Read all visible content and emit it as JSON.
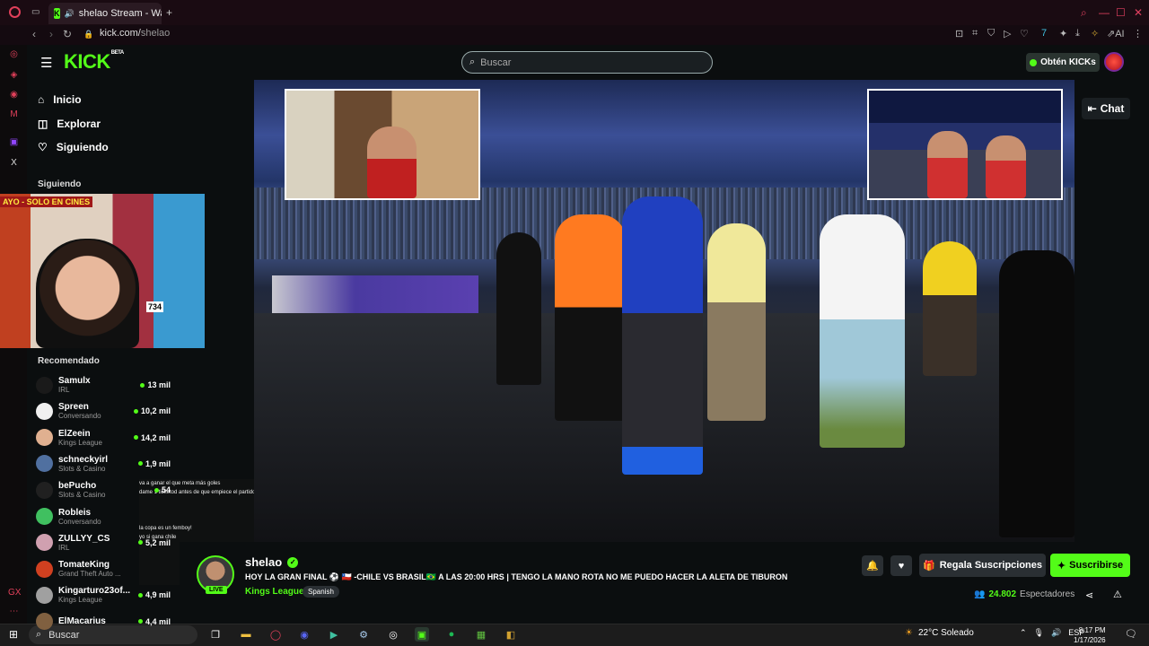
{
  "browser": {
    "tab_title": "shelao Stream - Watch",
    "new_tab": "+",
    "url": "kick.com/shelao",
    "url_host": "kick.com/",
    "url_path": "shelao",
    "ai_label": "AI"
  },
  "header": {
    "logo": "KICK",
    "logo_badge": "BETA",
    "search_placeholder": "Buscar",
    "get_kicks": "Obtén KICKs"
  },
  "sidebar": {
    "nav": [
      {
        "label": "Inicio",
        "icon": "home-icon"
      },
      {
        "label": "Explorar",
        "icon": "explore-icon"
      },
      {
        "label": "Siguiendo",
        "icon": "heart-icon"
      }
    ],
    "following_heading": "Siguiendo",
    "recommended_heading": "Recomendado",
    "recommended": [
      {
        "name": "Samulx",
        "category": "IRL",
        "viewers": "13 mil",
        "color": "#1a1a1a"
      },
      {
        "name": "Spreen",
        "category": "Conversando",
        "viewers": "10,2 mil",
        "color": "#f0f0f0"
      },
      {
        "name": "ElZeein",
        "category": "Kings League",
        "viewers": "14,2 mil",
        "color": "#e0b090"
      },
      {
        "name": "schneckyirl",
        "category": "Slots & Casino",
        "viewers": "1,9 mil",
        "color": "#5070a0"
      },
      {
        "name": "bePucho",
        "category": "Slots & Casino",
        "viewers": "54",
        "color": "#202020"
      },
      {
        "name": "Robleis",
        "category": "Conversando",
        "viewers": "",
        "color": "#40c060"
      },
      {
        "name": "ZULLYY_CS",
        "category": "IRL",
        "viewers": "5,2 mil",
        "color": "#d0a0b0"
      },
      {
        "name": "TomateKing",
        "category": "Grand Theft Auto ...",
        "viewers": "",
        "color": "#d04020"
      },
      {
        "name": "Kingarturo23of...",
        "category": "Kings League",
        "viewers": "4,9 mil",
        "color": "#a0a0a0"
      },
      {
        "name": "ElMacarius",
        "category": "",
        "viewers": "4,4 mil",
        "color": "#806040"
      }
    ]
  },
  "webcam": {
    "sign_text": "AYO - SOLO EN CINES",
    "bib_number": "734"
  },
  "chat_overlay": {
    "lines": [
      "va a ganar el que meta más goles",
      "dame 1 ticketod antes de que empiece el partido",
      "",
      "",
      "",
      "la copa es un femboy!",
      "yo si gana chile"
    ]
  },
  "video": {
    "chat_button": "Chat"
  },
  "stream": {
    "channel": "shelao",
    "live_badge": "LIVE",
    "title": "HOY LA GRAN FINAL ⚽ 🇨🇱 -CHILE VS BRASIL🇧🇷 A LAS 20:00 HRS | TENGO LA MANO ROTA NO ME PUEDO HACER LA ALETA DE TIBURON",
    "category": "Kings League",
    "language": "Spanish",
    "gift_label": "Regala Suscripciones",
    "subscribe_label": "Suscribirse",
    "viewers_count": "24.802",
    "viewers_label": "Espectadores"
  },
  "taskbar": {
    "search_placeholder": "Buscar",
    "weather": "22°C  Soleado",
    "language": "ESP",
    "time": "8:17 PM",
    "date": "1/17/2026"
  },
  "colors": {
    "accent": "#53fc18",
    "opera_red": "#e0405a",
    "background": "#0b0e0f"
  }
}
